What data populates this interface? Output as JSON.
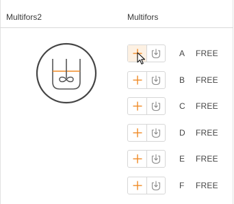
{
  "header": {
    "left_title": "Multifors2",
    "right_title": "Multifors"
  },
  "slots": [
    {
      "letter": "A",
      "status": "FREE",
      "hovered": true
    },
    {
      "letter": "B",
      "status": "FREE",
      "hovered": false
    },
    {
      "letter": "C",
      "status": "FREE",
      "hovered": false
    },
    {
      "letter": "D",
      "status": "FREE",
      "hovered": false
    },
    {
      "letter": "E",
      "status": "FREE",
      "hovered": false
    },
    {
      "letter": "F",
      "status": "FREE",
      "hovered": false
    }
  ],
  "icons": {
    "add": "plus-icon",
    "load": "load-icon",
    "vessel": "bioreactor-vessel-icon"
  },
  "colors": {
    "accent": "#f08a24",
    "hover_bg": "#fdf1e3",
    "icon_gray": "#8a8a8a",
    "text": "#444444"
  }
}
